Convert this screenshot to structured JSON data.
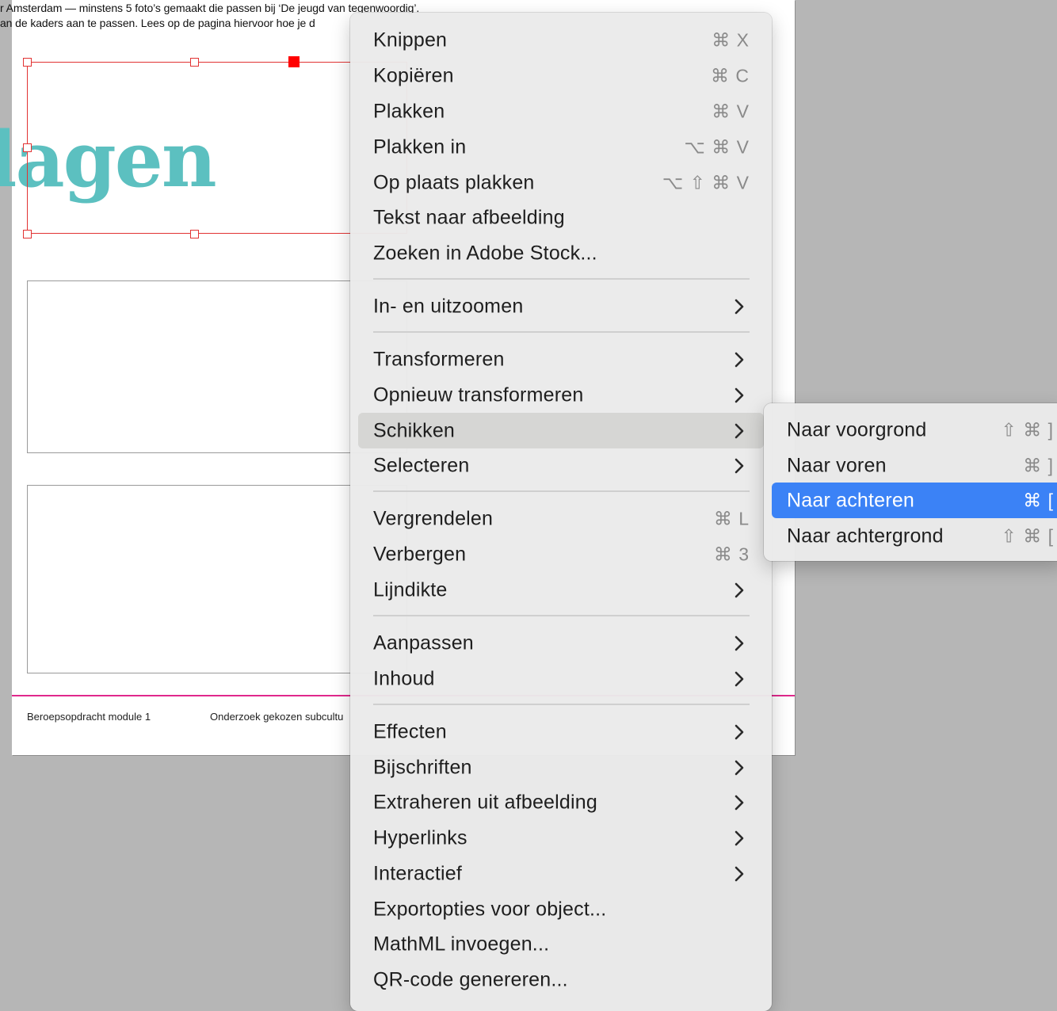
{
  "document": {
    "line1": "r Amsterdam — minstens 5 foto’s gemaakt die passen bij ‘De jeugd van tegenwoordig’.",
    "line2": "an de kaders aan te passen. Lees op de pagina hiervoor hoe je d",
    "heading_fragment": "lagen",
    "footer_left": "Beroepsopdracht  module 1",
    "footer_center": "Onderzoek gekozen subcultu",
    "colors": {
      "heading": "#5cc0c0",
      "footer_rule": "#e0288c",
      "selection": "#e23333"
    }
  },
  "context_menu": {
    "items": [
      {
        "label": "Knippen",
        "shortcut": "⌘ X"
      },
      {
        "label": "Kopiëren",
        "shortcut": "⌘ C"
      },
      {
        "label": "Plakken",
        "shortcut": "⌘ V"
      },
      {
        "label": "Plakken in",
        "shortcut": "⌥ ⌘ V"
      },
      {
        "label": "Op plaats plakken",
        "shortcut": "⌥ ⇧ ⌘ V"
      },
      {
        "label": "Tekst naar afbeelding"
      },
      {
        "label": "Zoeken in Adobe Stock..."
      },
      {
        "label": "In- en uitzoomen",
        "submenu": true
      },
      {
        "label": "Transformeren",
        "submenu": true
      },
      {
        "label": "Opnieuw transformeren",
        "submenu": true
      },
      {
        "label": "Schikken",
        "submenu": true,
        "active": true
      },
      {
        "label": "Selecteren",
        "submenu": true
      },
      {
        "label": "Vergrendelen",
        "shortcut": "⌘ L"
      },
      {
        "label": "Verbergen",
        "shortcut": "⌘ 3"
      },
      {
        "label": "Lijndikte",
        "submenu": true
      },
      {
        "label": "Aanpassen",
        "submenu": true
      },
      {
        "label": "Inhoud",
        "submenu": true
      },
      {
        "label": "Effecten",
        "submenu": true
      },
      {
        "label": "Bijschriften",
        "submenu": true
      },
      {
        "label": "Extraheren uit afbeelding",
        "submenu": true
      },
      {
        "label": "Hyperlinks",
        "submenu": true
      },
      {
        "label": "Interactief",
        "submenu": true
      },
      {
        "label": "Exportopties voor object..."
      },
      {
        "label": "MathML invoegen..."
      },
      {
        "label": "QR-code genereren..."
      }
    ],
    "chevron_icon": "chevron-right-icon"
  },
  "submenu": {
    "items": [
      {
        "label": "Naar voorgrond",
        "shortcut": "⇧ ⌘ ]"
      },
      {
        "label": "Naar voren",
        "shortcut": "⌘ ]"
      },
      {
        "label": "Naar achteren",
        "shortcut": "⌘ [",
        "highlighted": true
      },
      {
        "label": "Naar achtergrond",
        "shortcut": "⇧ ⌘ ["
      }
    ],
    "highlight_color": "#3b82f6"
  }
}
